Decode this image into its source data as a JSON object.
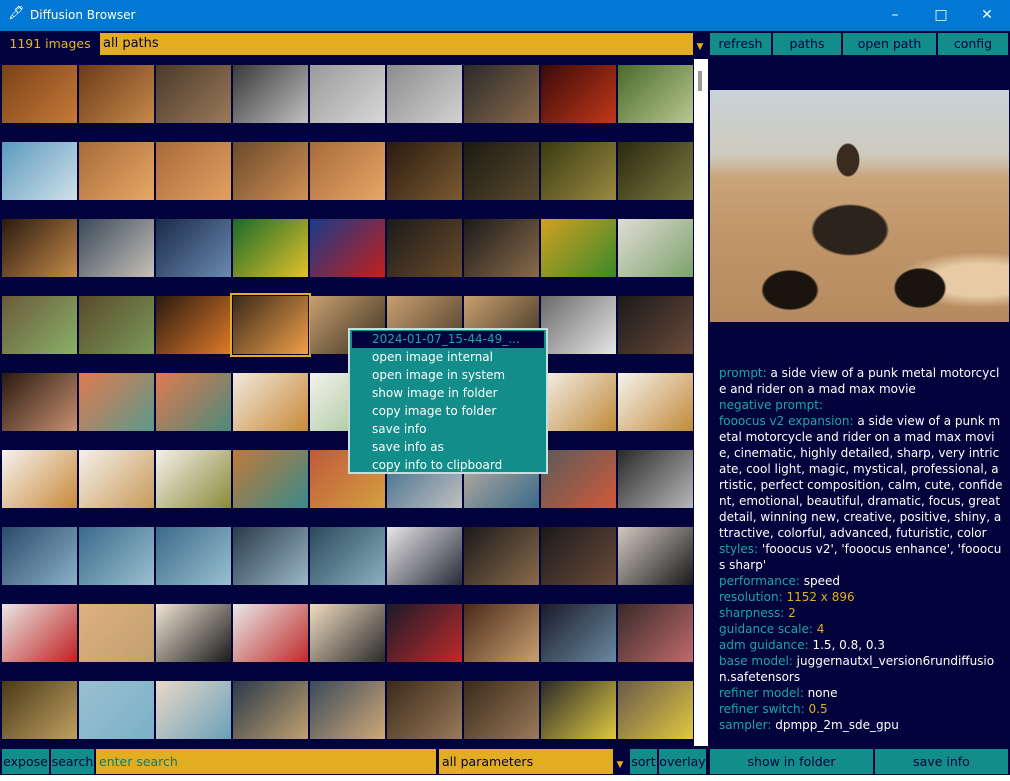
{
  "window": {
    "title": "Diffusion Browser",
    "icon": "feather-icon"
  },
  "toolbar": {
    "image_count": "1191 images",
    "path_selected": "all paths",
    "refresh": "refresh",
    "paths": "paths",
    "open_path": "open path",
    "config": "config"
  },
  "context_menu": {
    "header": "2024-01-07_15-44-49_...",
    "items": [
      "open image internal",
      "open image in system",
      "show image in folder",
      "copy image to folder",
      "save info",
      "save info as",
      "copy info to clipboard"
    ]
  },
  "info": {
    "prompt_key": "prompt:",
    "prompt_val": " a side view of a punk metal motorcycle and rider on a mad max movie",
    "neg_key": "negative prompt:",
    "exp_key": "fooocus v2 expansion:",
    "exp_val": " a side view of a punk metal motorcycle and rider on a mad max movie, cinematic, highly detailed, sharp, very intricate, cool light, magic, mystical, professional, artistic, perfect composition, calm, cute, confident, emotional, beautiful, dramatic, focus, great detail, winning new, creative, positive, shiny, attractive, colorful, advanced, futuristic, color",
    "styles_key": "styles:",
    "styles_val": " 'fooocus v2', 'fooocus enhance', 'fooocus sharp'",
    "perf_key": "performance:",
    "perf_val": " speed",
    "res_key": "resolution:",
    "res_val": " 1152 x 896",
    "sharp_key": "sharpness:",
    "sharp_val": " 2",
    "guid_key": "guidance scale:",
    "guid_val": " 4",
    "adm_key": "adm guidance:",
    "adm_val": " 1.5, 0.8, 0.3",
    "base_key": "base model:",
    "base_val": " juggernautxl_version6rundiffusion.safetensors",
    "refm_key": "refiner model:",
    "refm_val": " none",
    "refs_key": "refiner switch:",
    "refs_val": " 0.5",
    "samp_key": "sampler:",
    "samp_val": " dpmpp_2m_sde_gpu"
  },
  "bottom": {
    "expose": "expose",
    "search": "search",
    "search_placeholder": "enter search",
    "param_selected": "all parameters",
    "sort": "sort",
    "overlay": "overlay",
    "show_in_folder": "show in folder",
    "save_info": "save info"
  },
  "colors": {
    "background": "#02033d",
    "accent_teal": "#138d8a",
    "accent_gold": "#e3ad21",
    "key_text": "#1aa7a1",
    "titlebar": "#0078d4"
  },
  "thumbnails": [
    [
      "#7a4218",
      "#c77a38"
    ],
    [
      "#6b3a18",
      "#c68a4a"
    ],
    [
      "#4a3a2a",
      "#9a7a5a"
    ],
    [
      "#3a3a3a",
      "#bfbfbf"
    ],
    [
      "#9a9a9a",
      "#d8d8d8"
    ],
    [
      "#8c8c8c",
      "#d2d2d2"
    ],
    [
      "#2a2a2a",
      "#8a6a4a"
    ],
    [
      "#3a0a0a",
      "#c2381a"
    ],
    [
      "#4a6a2a",
      "#b8c890"
    ],
    [
      "#5a9abf",
      "#d0e0e8"
    ],
    [
      "#a86a3a",
      "#e7a865"
    ],
    [
      "#a86a3a",
      "#e2a060"
    ],
    [
      "#6a4a2a",
      "#d29055"
    ],
    [
      "#a86a3a",
      "#e6a866"
    ],
    [
      "#2a1a10",
      "#7a5a30"
    ],
    [
      "#1a1a10",
      "#5a4a30"
    ],
    [
      "#3a3a12",
      "#9a8a40"
    ],
    [
      "#2a2a10",
      "#7a7a40"
    ],
    [
      "#2a1a10",
      "#c48a4a"
    ],
    [
      "#3a4a5a",
      "#c7c0b8"
    ],
    [
      "#1a2a4a",
      "#6a8ab0"
    ],
    [
      "#1a6a2a",
      "#e3c12a"
    ],
    [
      "#1a3a8a",
      "#c2201a"
    ],
    [
      "#1a1a1a",
      "#6a4a2a"
    ],
    [
      "#1a1a1a",
      "#8a6a4a"
    ],
    [
      "#d2a020",
      "#3a8a2a"
    ],
    [
      "#e0dcd6",
      "#7ca26a"
    ],
    [
      "#6a5a3a",
      "#8ab068"
    ],
    [
      "#5a4a2a",
      "#7a9a5a"
    ],
    [
      "#2a1a10",
      "#e07a2a"
    ],
    [
      "#3a2a1a",
      "#f0a04a"
    ],
    [
      "#c8a070",
      "#3a3020"
    ],
    [
      "#c8a070",
      "#4a3a2a"
    ],
    [
      "#c8a070",
      "#3a3020"
    ],
    [
      "#6a6a6a",
      "#e6e6e6"
    ],
    [
      "#1a1a1a",
      "#6a4a3a"
    ],
    [
      "#2a1a10",
      "#c89070"
    ],
    [
      "#e07a50",
      "#5a9a8a"
    ],
    [
      "#e07a50",
      "#4a8a7a"
    ],
    [
      "#f0e8dc",
      "#c88a3a"
    ],
    [
      "#f4f2ee",
      "#9ac08a"
    ],
    [
      "#f4f0ea",
      "#c08a3a"
    ],
    [
      "#f4f0ea",
      "#c08a3a"
    ],
    [
      "#f4f0ea",
      "#c08a3a"
    ],
    [
      "#f6f2ee",
      "#c08a3a"
    ],
    [
      "#f6f2ee",
      "#c88a3a"
    ],
    [
      "#f4f0ea",
      "#c89a5a"
    ],
    [
      "#f4f0ea",
      "#8a8a3a"
    ],
    [
      "#c07a3a",
      "#3a8a8a"
    ],
    [
      "#c05a3a",
      "#d4a040"
    ],
    [
      "#3a6a8a",
      "#c0c0c0"
    ],
    [
      "#c0b0a0",
      "#3a6a8a"
    ],
    [
      "#5a5a5a",
      "#d05a3a"
    ],
    [
      "#2a2a2a",
      "#b8b8b8"
    ],
    [
      "#2a4a6a",
      "#8ab0c8"
    ],
    [
      "#3a6a8a",
      "#9ac0d0"
    ],
    [
      "#3a6a8a",
      "#9ac0d0"
    ],
    [
      "#2a3a4a",
      "#9ab8c8"
    ],
    [
      "#2a4a5a",
      "#8ab0c0"
    ],
    [
      "#e6e6e6",
      "#2a2a3a"
    ],
    [
      "#1a1a1a",
      "#8a6a4a"
    ],
    [
      "#1a1a1a",
      "#6a4a3a"
    ],
    [
      "#d0c8c0",
      "#1a1a1a"
    ],
    [
      "#e8e6e4",
      "#c02020"
    ],
    [
      "#e0b080",
      "#c0a070"
    ],
    [
      "#f0e4d4",
      "#1a1a1a"
    ],
    [
      "#e8e8e8",
      "#c02a2a"
    ],
    [
      "#f0dcc0",
      "#2a2a2a"
    ],
    [
      "#1a1a2a",
      "#c02a2a"
    ],
    [
      "#4a2a1a",
      "#c8a070"
    ],
    [
      "#1a1a2a",
      "#6a8aa0"
    ],
    [
      "#3a2a2a",
      "#c06a6a"
    ],
    [
      "#4a3a1a",
      "#c0a060"
    ],
    [
      "#9ac0d0",
      "#7ab0c8"
    ],
    [
      "#e8d8c8",
      "#6aa0b8"
    ],
    [
      "#2a3a4a",
      "#c0a070"
    ],
    [
      "#3a4a5a",
      "#d0a878"
    ],
    [
      "#3a2a1a",
      "#9a7a5a"
    ],
    [
      "#3a2a1a",
      "#9a7a5a"
    ],
    [
      "#2a2a2a",
      "#e0c840"
    ],
    [
      "#6a5a4a",
      "#e0c840"
    ]
  ]
}
